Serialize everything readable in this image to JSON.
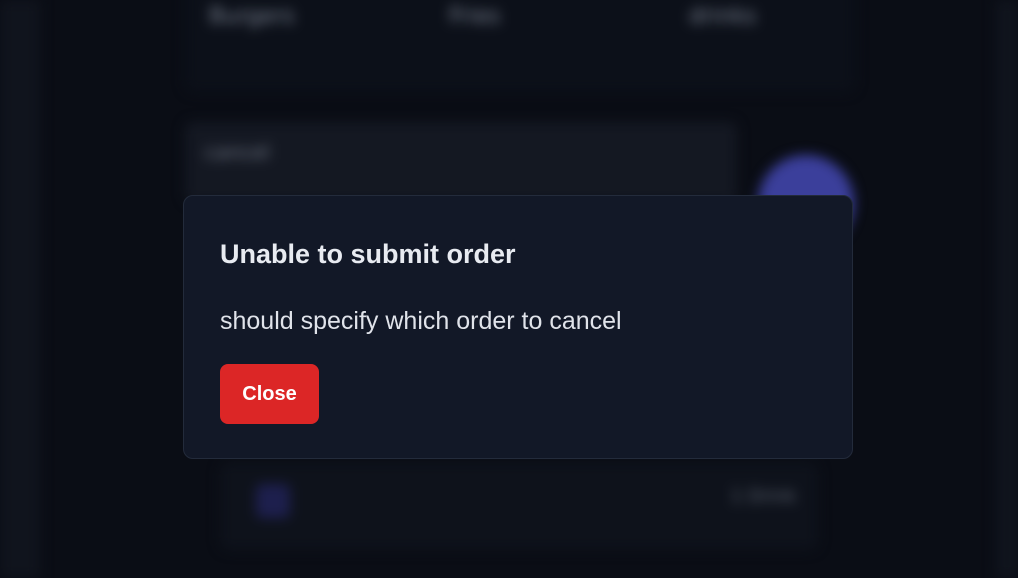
{
  "background": {
    "categories": [
      "Burgers",
      "Fries",
      "drinks"
    ],
    "input_value": "cancel",
    "bottom_label": "1 Drink"
  },
  "dialog": {
    "title": "Unable to submit order",
    "message": "should specify which order to cancel",
    "close_label": "Close"
  },
  "colors": {
    "accent": "#dc2626",
    "modal_bg": "#121827",
    "fab": "#3b3f9b"
  }
}
